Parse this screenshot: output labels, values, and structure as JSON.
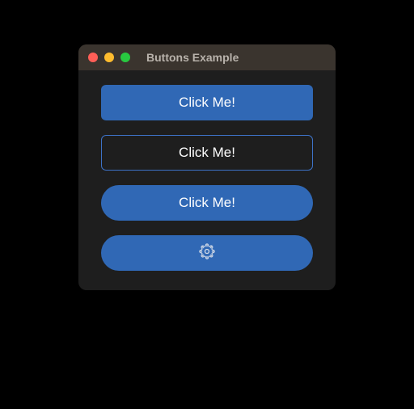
{
  "window": {
    "title": "Buttons Example"
  },
  "buttons": {
    "flat": {
      "label": "Click Me!"
    },
    "outlined": {
      "label": "Click Me!"
    },
    "pill": {
      "label": "Click Me!"
    },
    "icon": {
      "icon_name": "gear-icon"
    }
  }
}
